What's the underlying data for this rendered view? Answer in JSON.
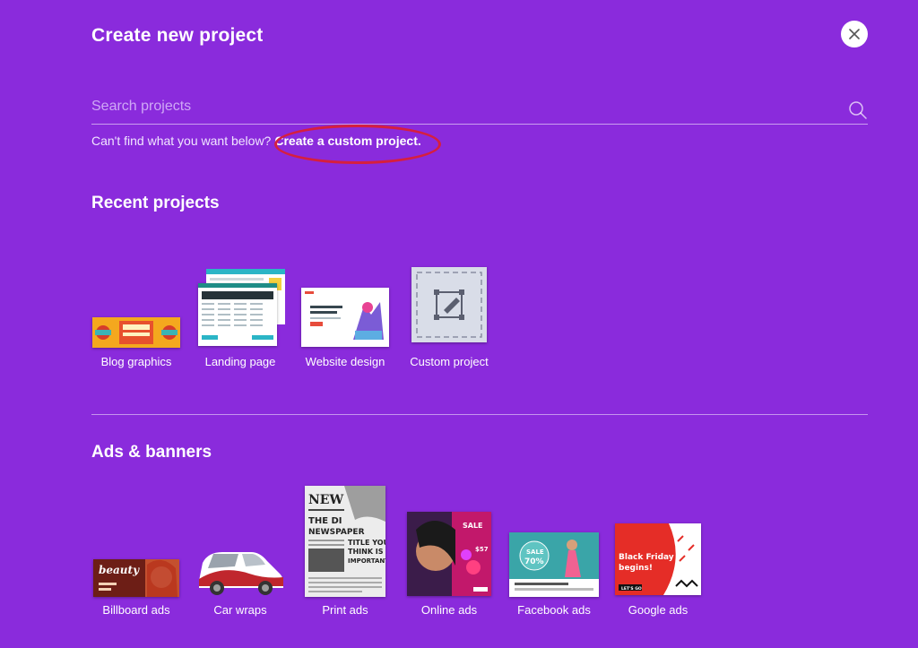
{
  "dialog": {
    "title": "Create new project",
    "close_label": "×"
  },
  "search": {
    "placeholder": "Search projects"
  },
  "hint": {
    "text": "Can't find what you want below?",
    "link": "Create a custom project."
  },
  "recent": {
    "title": "Recent projects",
    "items": [
      {
        "label": "Blog graphics",
        "icon": "blog-graphics-thumbnail"
      },
      {
        "label": "Landing page",
        "icon": "landing-page-thumbnail"
      },
      {
        "label": "Website design",
        "icon": "website-design-thumbnail"
      },
      {
        "label": "Custom project",
        "icon": "custom-project-thumbnail"
      }
    ]
  },
  "ads": {
    "title": "Ads & banners",
    "items": [
      {
        "label": "Billboard ads",
        "icon": "billboard-ads-thumbnail"
      },
      {
        "label": "Car wraps",
        "icon": "car-wraps-thumbnail"
      },
      {
        "label": "Print ads",
        "icon": "print-ads-thumbnail"
      },
      {
        "label": "Online ads",
        "icon": "online-ads-thumbnail"
      },
      {
        "label": "Facebook ads",
        "icon": "facebook-ads-thumbnail"
      },
      {
        "label": "Google ads",
        "icon": "google-ads-thumbnail"
      }
    ]
  },
  "thumb_text": {
    "billboard_brand": "beauty",
    "print_headline_1": "NEW",
    "print_headline_2": "THE DI",
    "print_headline_3": "NEWSPAPER",
    "print_headline_4": "TITLE YOU",
    "print_headline_5": "THINK IS",
    "print_headline_6": "IMPORTANT",
    "online_sale": "SALE",
    "online_value": "$57",
    "facebook_sale": "SALE",
    "facebook_value": "70%",
    "google_line1": "Black Friday",
    "google_line2": "begins!",
    "google_button": "LET'S GO"
  },
  "colors": {
    "background": "#8a2bdc",
    "annotation": "#d61f3e"
  }
}
